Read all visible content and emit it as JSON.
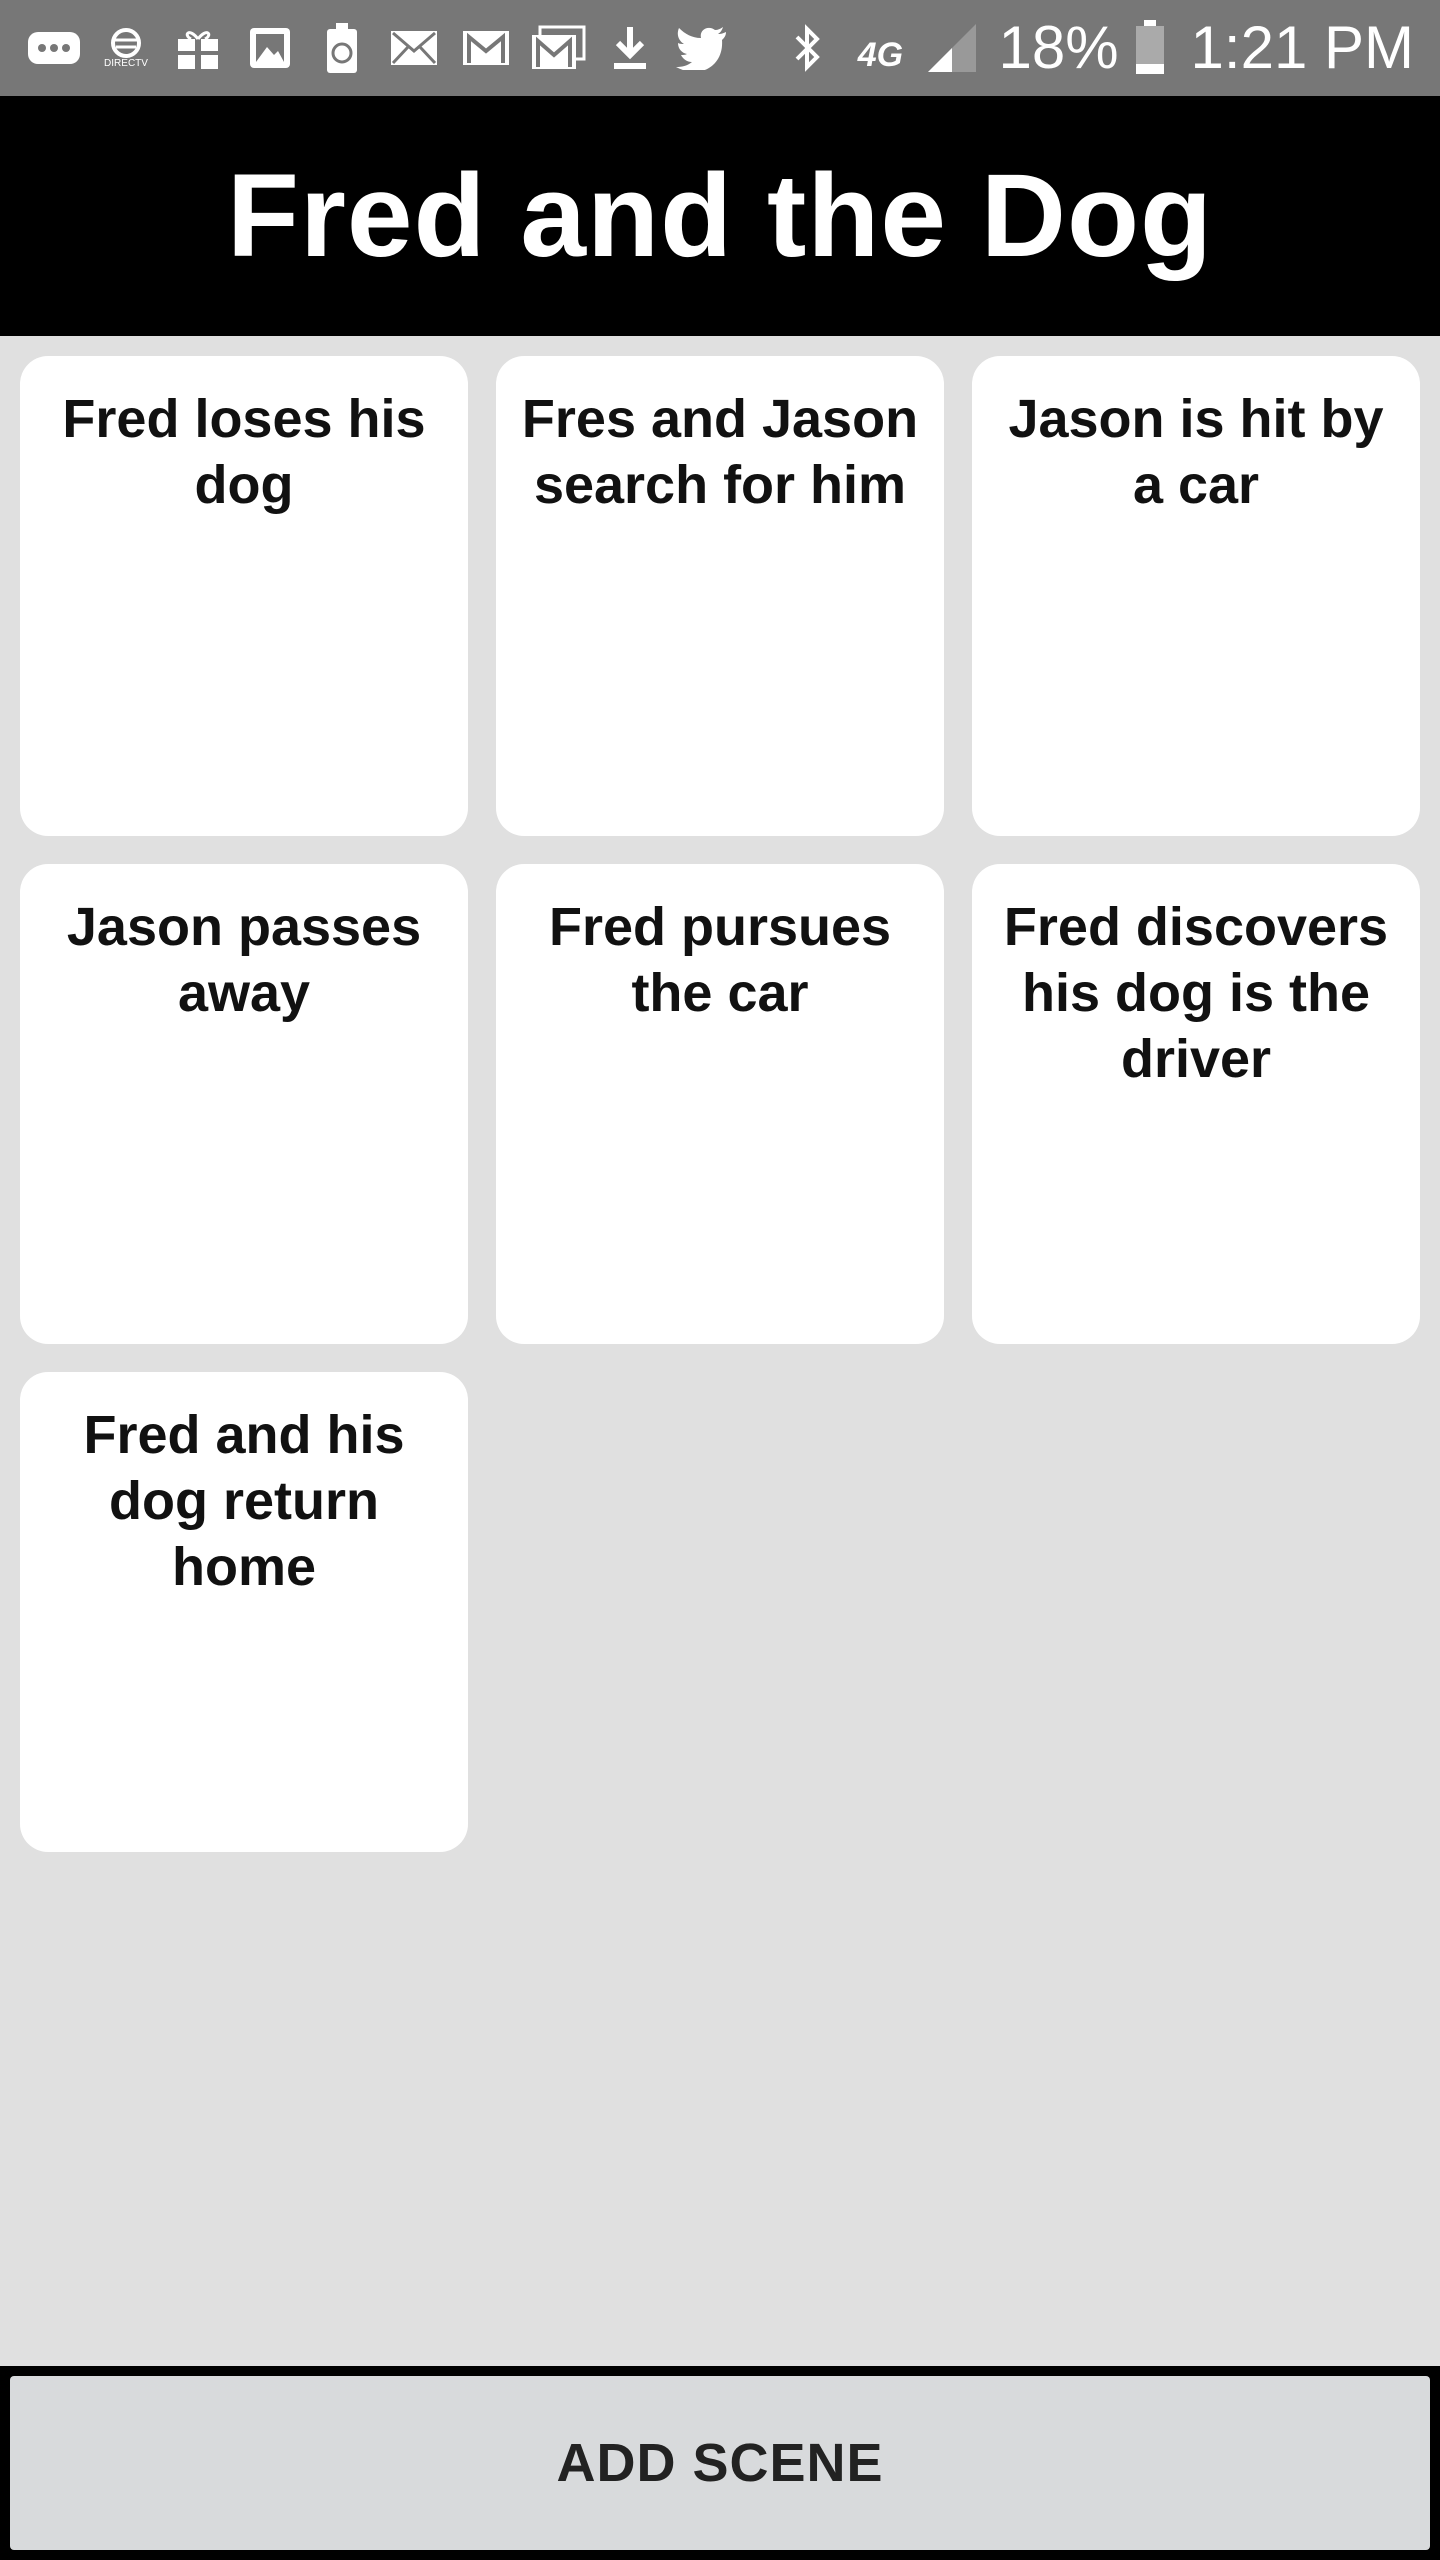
{
  "status_bar": {
    "left_icons": [
      "more-dots-icon",
      "att-directv-icon",
      "gift-icon",
      "image-icon",
      "battery-recycle-icon",
      "email-icon",
      "gmail-icon",
      "gmail-stack-icon",
      "download-icon",
      "twitter-icon"
    ],
    "right_icons": [
      "bluetooth-icon",
      "network-4g-icon",
      "signal-icon"
    ],
    "network_label": "4G",
    "carrier_label": "DIRECTV",
    "battery_percent": "18%",
    "time": "1:21 PM"
  },
  "header": {
    "title": "Fred and the Dog"
  },
  "scenes": [
    {
      "label": "Fred loses his dog"
    },
    {
      "label": "Fres and Jason search for him"
    },
    {
      "label": "Jason is hit by a car"
    },
    {
      "label": "Jason passes away"
    },
    {
      "label": "Fred pursues the car"
    },
    {
      "label": "Fred discovers his dog is the driver"
    },
    {
      "label": "Fred and his dog return home"
    }
  ],
  "actions": {
    "add_scene_label": "ADD SCENE"
  },
  "colors": {
    "status_bar_bg": "#777777",
    "header_bg": "#000000",
    "page_bg": "#e0e0e0",
    "card_bg": "#ffffff",
    "button_bg": "#d8dadc"
  }
}
